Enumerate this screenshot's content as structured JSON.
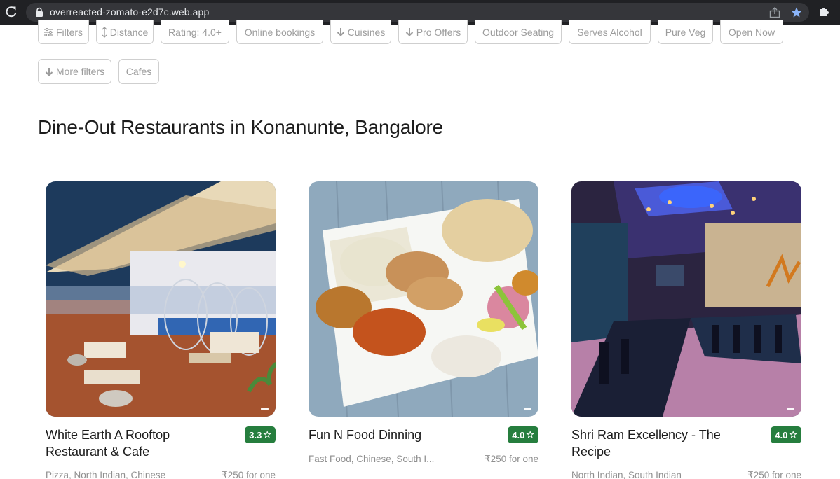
{
  "browser": {
    "url": "overreacted-zomato-e2d7c.web.app"
  },
  "filters": {
    "row1": [
      {
        "label": "Filters",
        "icon": "sliders-icon"
      },
      {
        "label": "Distance",
        "icon": "vertical-arrows-icon"
      },
      {
        "label": "Rating: 4.0+"
      },
      {
        "label": "Online bookings"
      },
      {
        "label": "Cuisines",
        "icon": "arrow-down-icon"
      },
      {
        "label": "Pro Offers",
        "icon": "arrow-down-icon"
      },
      {
        "label": "Outdoor Seating"
      },
      {
        "label": "Serves Alcohol"
      },
      {
        "label": "Pure Veg"
      },
      {
        "label": "Open Now"
      }
    ],
    "row2": [
      {
        "label": "More filters",
        "icon": "arrow-down-icon"
      },
      {
        "label": "Cafes"
      }
    ]
  },
  "page": {
    "title": "Dine-Out Restaurants in Konanunte, Bangalore"
  },
  "restaurants": [
    {
      "name": "White Earth A Rooftop Restaurant & Cafe",
      "rating": "3.3",
      "cuisine": "Pizza, North Indian, Chinese",
      "price": "₹250 for one"
    },
    {
      "name": "Fun N Food Dinning",
      "rating": "4.0",
      "cuisine": "Fast Food, Chinese, South I...",
      "price": "₹250 for one"
    },
    {
      "name": "Shri Ram Excellency - The Recipe",
      "rating": "4.0",
      "cuisine": "North Indian, South Indian",
      "price": "₹250 for one"
    }
  ],
  "colors": {
    "rating_badge": "#267e3e",
    "chrome_bg": "#202124",
    "star_active": "#8ab4f8"
  }
}
